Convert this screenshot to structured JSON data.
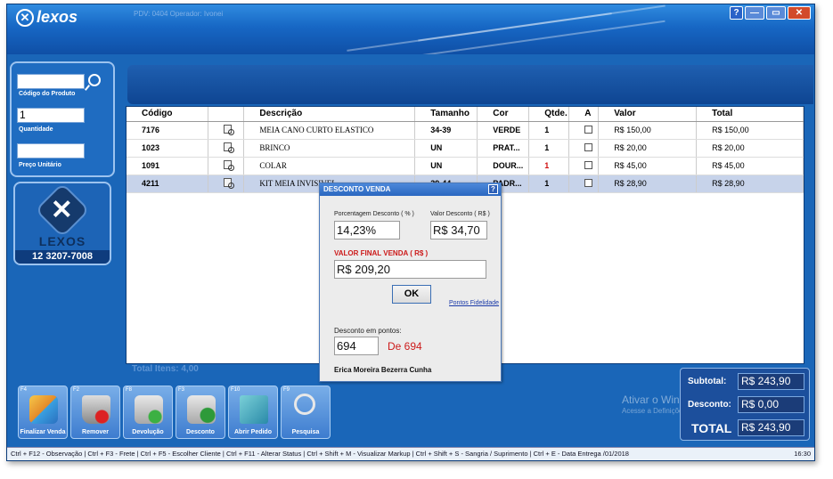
{
  "window": {
    "app_name": "lexos",
    "pdv_text": "PDV: 0404    Operador: Ivonei",
    "help_label": "?",
    "min_label": "—",
    "max_label": "▭",
    "close_label": "✕"
  },
  "left_panel": {
    "codigo_value": "",
    "codigo_label": "Código do Produto",
    "quantidade_value": "1",
    "quantidade_label": "Quantidade",
    "preco_value": "",
    "preco_label": "Preço Unitário"
  },
  "brand": {
    "name": "LEXOS",
    "phone": "12 3207-7008"
  },
  "grid": {
    "headers": [
      "Código",
      "",
      "Descrição",
      "Tamanho",
      "Cor",
      "Qtde.",
      "A",
      "Valor",
      "Total"
    ],
    "rows": [
      {
        "codigo": "7176",
        "descricao": "MEIA CANO CURTO ELASTICO",
        "tamanho": "34-39",
        "cor": "VERDE",
        "qtde": "1",
        "valor": "R$ 150,00",
        "total": "R$ 150,00"
      },
      {
        "codigo": "1023",
        "descricao": "BRINCO",
        "tamanho": "UN",
        "cor": "PRAT...",
        "qtde": "1",
        "valor": "R$ 20,00",
        "total": "R$ 20,00"
      },
      {
        "codigo": "1091",
        "descricao": "COLAR",
        "tamanho": "UN",
        "cor": "DOUR...",
        "qtde": "1",
        "valor": "R$ 45,00",
        "total": "R$ 45,00"
      },
      {
        "codigo": "4211",
        "descricao": "KIT MEIA INVISIVEL",
        "tamanho": "39-44",
        "cor": "PADR...",
        "qtde": "1",
        "valor": "R$ 28,90",
        "total": "R$ 28,90"
      }
    ],
    "total_itens": "Total Itens: 4,00"
  },
  "dialog": {
    "title": "DESCONTO VENDA",
    "help": "?",
    "pct_label": "Porcentagem Desconto ( % )",
    "pct_value": "14,23%",
    "valor_label": "Valor Desconto ( R$ )",
    "valor_value": "R$ 34,70",
    "final_label": "VALOR FINAL VENDA ( R$ )",
    "final_value": "R$ 209,20",
    "ok_label": "OK",
    "fidelidade_link": "Pontos Fidelidade",
    "pontos_label": "Desconto em pontos:",
    "pontos_value": "694",
    "pontos_de": "De 694",
    "cliente": "Erica Moreira Bezerra Cunha"
  },
  "toolbar": [
    {
      "key": "F4",
      "label": "Finalizar Venda",
      "icon": "credit-cards-icon"
    },
    {
      "key": "F2",
      "label": "Remover",
      "icon": "trash-remove-icon"
    },
    {
      "key": "F8",
      "label": "Devolução",
      "icon": "cart-return-icon"
    },
    {
      "key": "F3",
      "label": "Desconto",
      "icon": "cart-discount-icon"
    },
    {
      "key": "F10",
      "label": "Abrir Pedido",
      "icon": "notebook-icon"
    },
    {
      "key": "F9",
      "label": "Pesquisa",
      "icon": "magnifier-icon"
    }
  ],
  "summary": {
    "subtotal_label": "Subtotal:",
    "subtotal_value": "R$ 243,90",
    "desconto_label": "Desconto:",
    "desconto_value": "R$ 0,00",
    "total_label": "TOTAL",
    "total_value": "R$ 243,90"
  },
  "watermark": {
    "line1": "Ativar o Windows",
    "line2": "Acesse a Definições para ativar o Windows."
  },
  "statusbar": {
    "shortcuts": "Ctrl + F12 - Observação   |   Ctrl + F3 - Frete   |   Ctrl + F5 - Escolher Cliente   |   Ctrl + F11 - Alterar Status   |   Ctrl + Shift + M - Visualizar Markup   |   Ctrl + Shift + S - Sangria / Suprimento   |   Ctrl + E - Data Entrega /01/2018",
    "clock": "16:30"
  },
  "colors": {
    "window_bg": "#1a66b8",
    "accent": "#0e4592",
    "discount_red": "#cc1a1a"
  }
}
